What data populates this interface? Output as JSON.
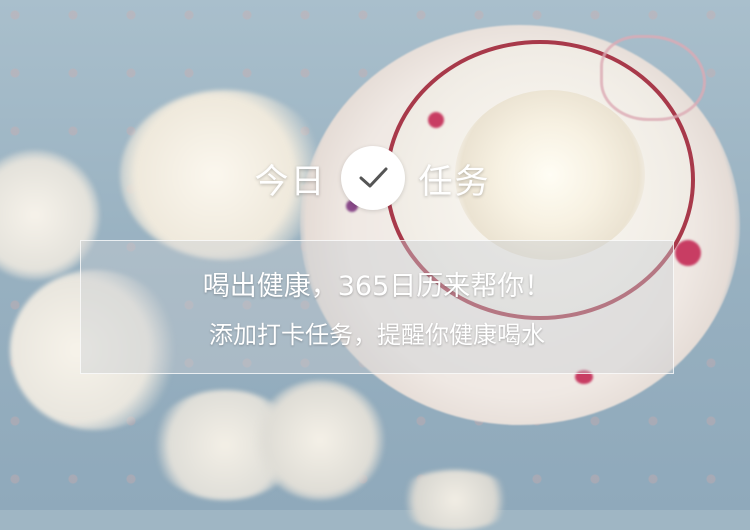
{
  "header": {
    "title_left": "今日",
    "title_right": "任务",
    "check_icon": "checkmark-icon"
  },
  "banner": {
    "line1": "喝出健康，365日历来帮你！",
    "line2": "添加打卡任务，提醒你健康喝水"
  },
  "colors": {
    "text": "#ffffff",
    "check_circle": "#ffffff",
    "check_mark": "#555555",
    "cup_rim": "#a8394a"
  }
}
